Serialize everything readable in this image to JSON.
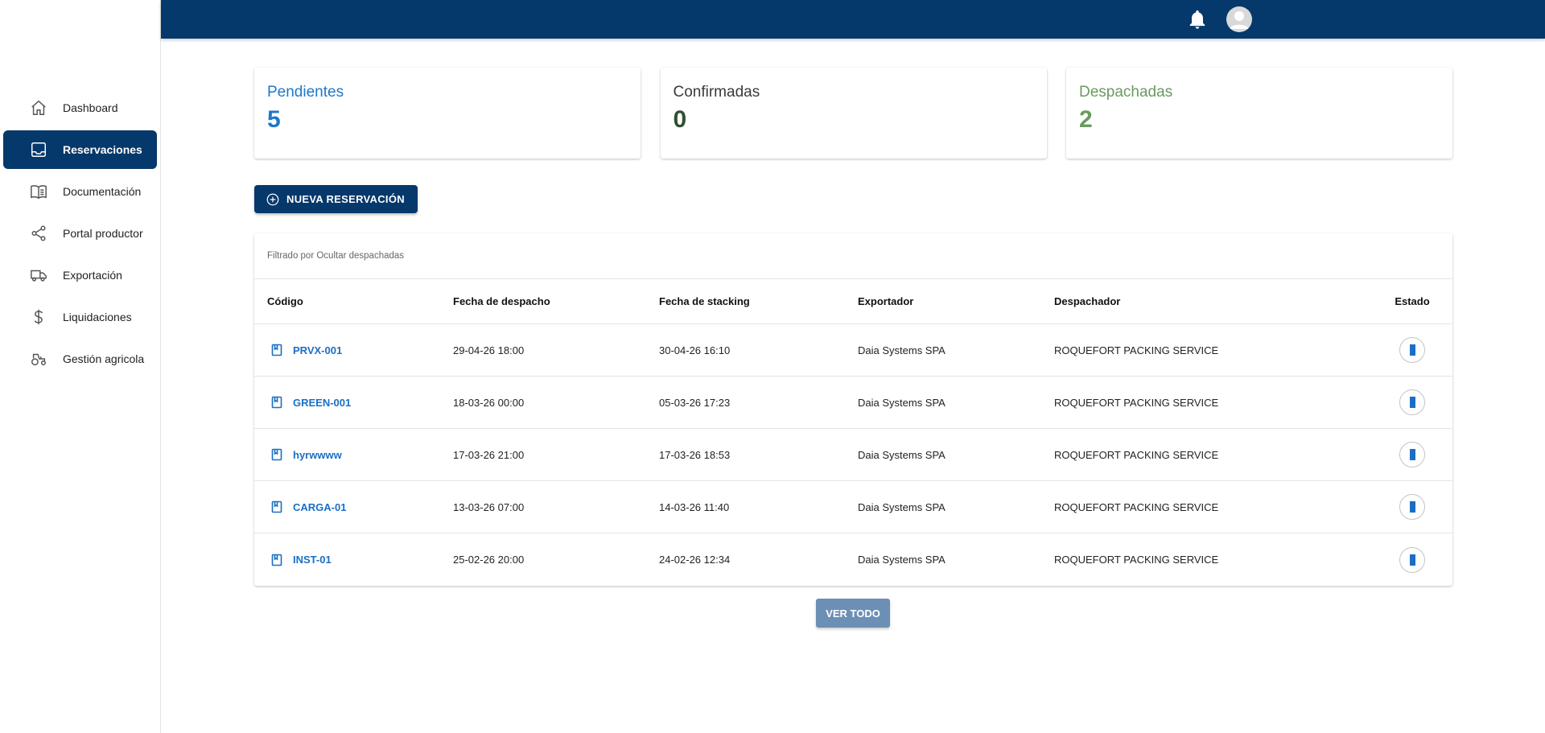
{
  "colors": {
    "primary": "#05386b",
    "pendientes": "#1f77c9",
    "confirmadas": "#2f5030",
    "despachadas": "#6a9a5f",
    "link": "#1a6fc4"
  },
  "sidebar": {
    "items": [
      {
        "label": "Dashboard",
        "icon": "home-icon",
        "active": false
      },
      {
        "label": "Reservaciones",
        "icon": "inbox-icon",
        "active": true
      },
      {
        "label": "Documentación",
        "icon": "book-icon",
        "active": false
      },
      {
        "label": "Portal productor",
        "icon": "share-icon",
        "active": false
      },
      {
        "label": "Exportación",
        "icon": "truck-icon",
        "active": false
      },
      {
        "label": "Liquidaciones",
        "icon": "dollar-icon",
        "active": false
      },
      {
        "label": "Gestión agricola",
        "icon": "tractor-icon",
        "active": false
      }
    ]
  },
  "topbar": {
    "bell_icon": "bell-icon",
    "avatar_icon": "account-circle-icon"
  },
  "stats": [
    {
      "title": "Pendientes",
      "value": "5"
    },
    {
      "title": "Confirmadas",
      "value": "0"
    },
    {
      "title": "Despachadas",
      "value": "2"
    }
  ],
  "new_button": {
    "label": "NUEVA RESERVACIÓN",
    "icon": "add-circle-icon"
  },
  "table": {
    "filter_text": "Filtrado por Ocultar despachadas",
    "headers": [
      "Código",
      "Fecha de despacho",
      "Fecha de stacking",
      "Exportador",
      "Despachador",
      "Estado"
    ],
    "rows": [
      {
        "code": "PRVX-001",
        "despacho": "29-04-26 18:00",
        "stacking": "30-04-26 16:10",
        "exportador": "Daia Systems SPA",
        "despachador": "ROQUEFORT PACKING SERVICE"
      },
      {
        "code": "GREEN-001",
        "despacho": "18-03-26 00:00",
        "stacking": "05-03-26 17:23",
        "exportador": "Daia Systems SPA",
        "despachador": "ROQUEFORT PACKING SERVICE"
      },
      {
        "code": "hyrwwww",
        "despacho": "17-03-26 21:00",
        "stacking": "17-03-26 18:53",
        "exportador": "Daia Systems SPA",
        "despachador": "ROQUEFORT PACKING SERVICE"
      },
      {
        "code": "CARGA-01",
        "despacho": "13-03-26 07:00",
        "stacking": "14-03-26 11:40",
        "exportador": "Daia Systems SPA",
        "despachador": "ROQUEFORT PACKING SERVICE"
      },
      {
        "code": "INST-01",
        "despacho": "25-02-26 20:00",
        "stacking": "24-02-26 12:34",
        "exportador": "Daia Systems SPA",
        "despachador": "ROQUEFORT PACKING SERVICE"
      }
    ]
  },
  "view_all": {
    "label": "VER TODO"
  }
}
